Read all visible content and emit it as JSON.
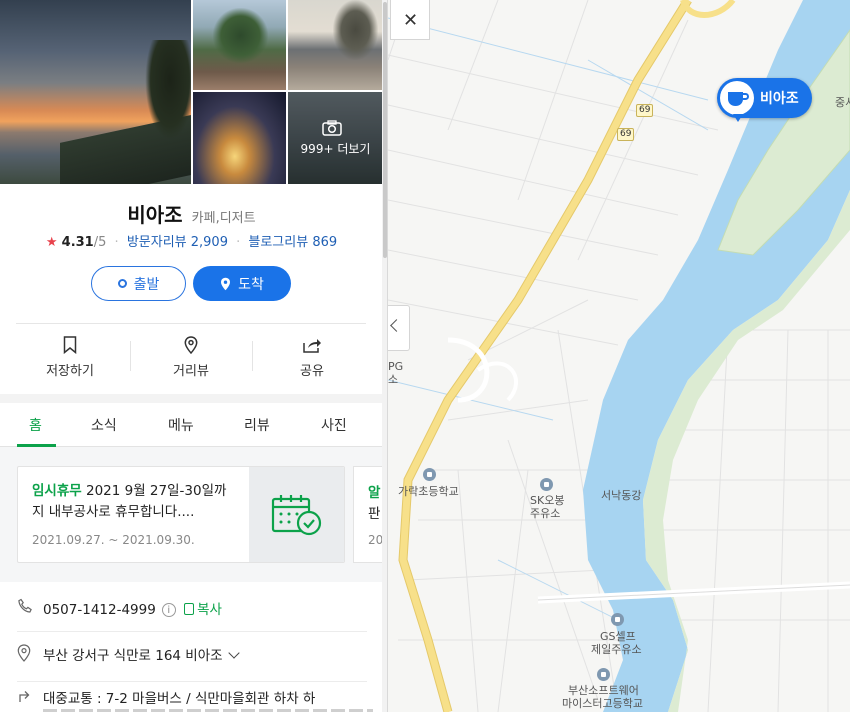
{
  "place": {
    "name": "비아조",
    "category": "카페,디저트",
    "rating_star": "★",
    "rating": "4.31",
    "rating_max": "/5",
    "visitor_reviews_label": "방문자리뷰 2,909",
    "blog_reviews_label": "블로그리뷰 869",
    "separator": "·"
  },
  "photos": {
    "more_label": "999+ 더보기"
  },
  "actions": {
    "depart": "출발",
    "arrive": "도착",
    "save": "저장하기",
    "street_view": "거리뷰",
    "share": "공유"
  },
  "tabs": [
    "홈",
    "소식",
    "메뉴",
    "리뷰",
    "사진"
  ],
  "notice": {
    "tag": "임시휴무",
    "text": " 2021 9월 27일-30일까지 내부공사로 휴무합니다....",
    "date": "2021.09.27. ~ 2021.09.30.",
    "next_tag": "알",
    "next_line2": "판",
    "next_date": "20"
  },
  "info": {
    "phone": "0507-1412-4999",
    "info_i": "i",
    "copy_label": "복사",
    "address": "부산 강서구 식만로 164 비아조",
    "transit": "대중교통 : 7-2 마을버스 / 식만마을회관 하차 하"
  },
  "map": {
    "close_icon": "✕",
    "marker_label": "비아조",
    "road_number": "69",
    "labels": {
      "school1": "가락초등학교",
      "gas1_line1": "SK오봉",
      "gas1_line2": "주유소",
      "river": "서낙동강",
      "gas2_line1": "GS셀프",
      "gas2_line2": "제일주유소",
      "school2_line1": "부산소프트웨어",
      "school2_line2": "마이스터고등학교",
      "partial_top": "중서",
      "partial_left1": "PG",
      "partial_left2": "소"
    },
    "colors": {
      "water": "#a7d4f1",
      "park": "#dcebd2",
      "road_major": "#f7e08a",
      "accent": "#1a73e8",
      "green": "#0ca24a"
    }
  }
}
